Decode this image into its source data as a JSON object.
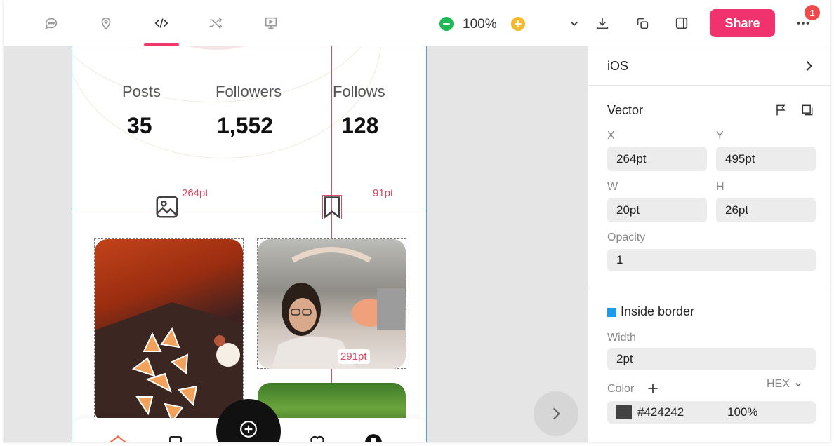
{
  "toolbar": {
    "icons": [
      "comment-icon",
      "location-pin-icon",
      "code-icon",
      "shuffle-icon",
      "presentation-icon"
    ],
    "zoom_level": "100%",
    "share_label": "Share",
    "notification_count": "1",
    "accent_color": "#f0386b"
  },
  "profile": {
    "stats": [
      {
        "label": "Posts",
        "value": "35"
      },
      {
        "label": "Followers",
        "value": "1,552"
      },
      {
        "label": "Follows",
        "value": "128"
      }
    ]
  },
  "measurements": {
    "left_distance": "264pt",
    "right_distance": "91pt",
    "photo_distance": "291pt"
  },
  "panel": {
    "platform": "iOS",
    "layer": {
      "title": "Vector",
      "x_label": "X",
      "x_value": "264pt",
      "y_label": "Y",
      "y_value": "495pt",
      "w_label": "W",
      "w_value": "20pt",
      "h_label": "H",
      "h_value": "26pt",
      "opacity_label": "Opacity",
      "opacity_value": "1"
    },
    "border": {
      "title": "Inside border",
      "swatch_color": "#1a9bf0",
      "width_label": "Width",
      "width_value": "2pt",
      "color_label": "Color",
      "format_label": "HEX",
      "color_value": "#424242",
      "color_opacity": "100%"
    }
  }
}
